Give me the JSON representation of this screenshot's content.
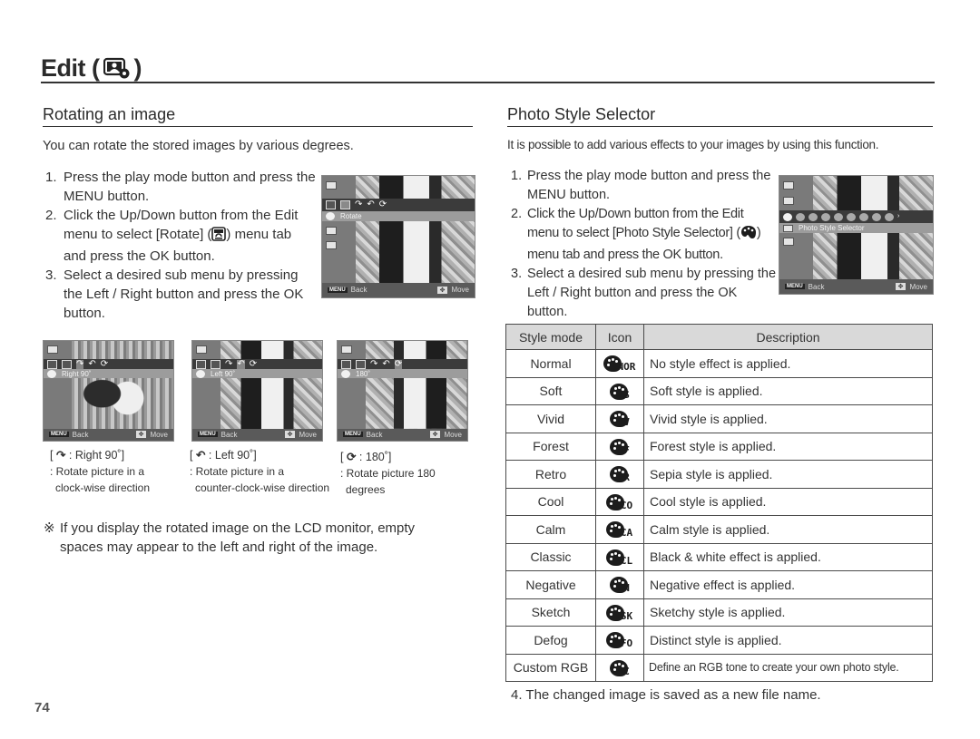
{
  "page": {
    "title": "Edit (",
    "title_close": ")",
    "title_icon": "edit-photo-gear-icon",
    "page_number": "74"
  },
  "rotate": {
    "title": "Rotating an image",
    "intro": "You can rotate the stored images by various degrees.",
    "steps": [
      {
        "num": "1.",
        "text": "Press the play mode button and press the MENU button."
      },
      {
        "num": "2.",
        "text_before": "Click the Up/Down button from the Edit menu to select [Rotate] (",
        "icon": "rotate-icon",
        "text_after": ") menu tab and press the OK button."
      },
      {
        "num": "3.",
        "text": "Select a desired sub menu by pressing the Left / Right button and press the OK button."
      }
    ],
    "lcd_main": {
      "label": "Rotate",
      "back": "Back",
      "move": "Move",
      "menu_chip": "MENU"
    },
    "options": [
      {
        "lcd_label": "Right 90˚",
        "icon": "rotate-right-icon",
        "head": ": Right 90˚]",
        "desc_line1": ": Rotate picture in a",
        "desc_line2": "clock-wise direction"
      },
      {
        "lcd_label": "Left 90˚",
        "icon": "rotate-left-icon",
        "head": ": Left 90˚]",
        "desc_line1": ": Rotate picture in a",
        "desc_line2": "counter-clock-wise direction"
      },
      {
        "lcd_label": "180˚",
        "icon": "rotate-180-icon",
        "head": ": 180˚]",
        "desc_line1": ": Rotate picture 180",
        "desc_line2": "degrees"
      }
    ],
    "note_symbol": "※",
    "note": "If you display the rotated image on the LCD monitor, empty spaces may appear to the left and right of the image."
  },
  "photo_style": {
    "title": "Photo Style Selector",
    "intro": "It is possible to add various effects to your images by using this function.",
    "steps": [
      {
        "num": "1.",
        "text": "Press the play mode button and press the MENU button."
      },
      {
        "num": "2.",
        "text_before": "Click the Up/Down button from the Edit menu to select [Photo Style Selector] (",
        "icon": "palette-icon",
        "text_after": ") menu tab and press the OK button."
      },
      {
        "num": "3.",
        "text": "Select a desired sub menu by pressing the Left / Right button and press the OK button."
      }
    ],
    "lcd": {
      "label": "Photo Style Selector",
      "back": "Back",
      "move": "Move",
      "menu_chip": "MENU"
    },
    "table": {
      "headers": [
        "Style mode",
        "Icon",
        "Description"
      ],
      "rows": [
        {
          "mode": "Normal",
          "code": "NOR",
          "desc": "No style effect is applied."
        },
        {
          "mode": "Soft",
          "code": "S",
          "desc": "Soft style is applied."
        },
        {
          "mode": "Vivid",
          "code": "V",
          "desc": "Vivid style is applied."
        },
        {
          "mode": "Forest",
          "code": "F",
          "desc": "Forest style is applied."
        },
        {
          "mode": "Retro",
          "code": "R",
          "desc": "Sepia style is applied."
        },
        {
          "mode": "Cool",
          "code": "CO",
          "desc": "Cool style is applied."
        },
        {
          "mode": "Calm",
          "code": "CA",
          "desc": "Calm style is applied."
        },
        {
          "mode": "Classic",
          "code": "CL",
          "desc": "Black & white effect is applied."
        },
        {
          "mode": "Negative",
          "code": "N",
          "desc": "Negative effect is applied."
        },
        {
          "mode": "Sketch",
          "code": "SK",
          "desc": "Sketchy style is applied."
        },
        {
          "mode": "Defog",
          "code": "FO",
          "desc": "Distinct style is applied."
        },
        {
          "mode": "Custom RGB",
          "code": "C",
          "desc": "Define an RGB tone to create your own photo style."
        }
      ]
    },
    "step4": "4. The changed image is saved as a new file name."
  }
}
